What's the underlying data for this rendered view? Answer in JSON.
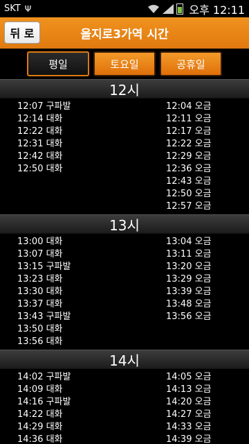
{
  "statusbar": {
    "carrier": "SKT",
    "usb_icon": "usb-icon",
    "time": "오후 12:11"
  },
  "header": {
    "back_label": "뒤 로",
    "title": "을지로3가역 시간"
  },
  "tabs": [
    {
      "label": "평일",
      "active": true
    },
    {
      "label": "토요일",
      "active": false
    },
    {
      "label": "공휴일",
      "active": false
    }
  ],
  "colors": {
    "accent": "#e07a10",
    "header_bg": "#2a2a2a"
  },
  "schedule": [
    {
      "hour": "12시",
      "left": [
        "12:07 구파발",
        "12:14 대화",
        "12:22 대화",
        "12:31 대화",
        "12:42 대화",
        "12:50 대화"
      ],
      "right": [
        "12:04 오금",
        "12:11 오금",
        "12:17 오금",
        "12:22 오금",
        "12:29 오금",
        "12:36 오금",
        "12:43 오금",
        "12:50 오금",
        "12:57 오금"
      ]
    },
    {
      "hour": "13시",
      "left": [
        "13:00 대화",
        "13:07 대화",
        "13:15 구파발",
        "13:23 대화",
        "13:30 대화",
        "13:37 대화",
        "13:43 구파발",
        "13:50 대화",
        "13:56 대화"
      ],
      "right": [
        "13:04 오금",
        "13:11 오금",
        "13:20 오금",
        "13:29 오금",
        "13:39 오금",
        "13:48 오금",
        "13:56 오금"
      ]
    },
    {
      "hour": "14시",
      "left": [
        "14:02 구파발",
        "14:09 대화",
        "14:16 구파발",
        "14:22 대화",
        "14:29 대화",
        "14:36 대화"
      ],
      "right": [
        "14:05 오금",
        "14:13 오금",
        "14:20 오금",
        "14:27 오금",
        "14:33 오금",
        "14:39 오금"
      ]
    }
  ]
}
